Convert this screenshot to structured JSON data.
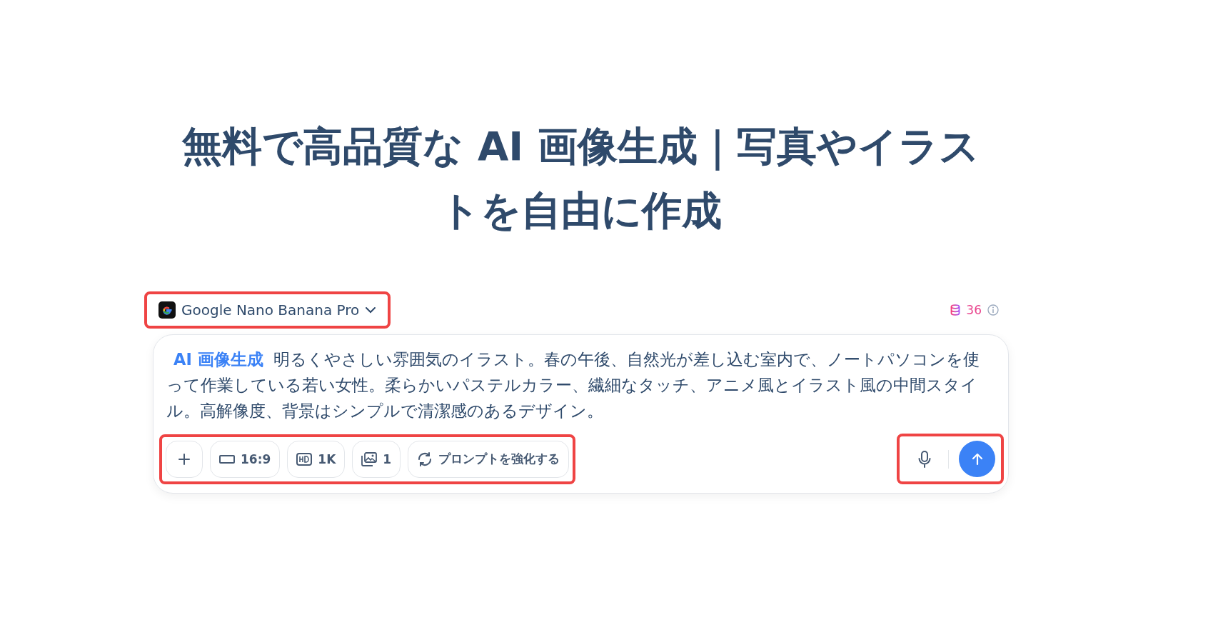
{
  "heading": "無料で高品質な AI 画像生成｜写真やイラストを自由に作成",
  "model_selector": {
    "label": "Google Nano Banana Pro",
    "highlighted": true
  },
  "credits": {
    "count": "36"
  },
  "prompt": {
    "tag": "AI 画像生成",
    "value": "明るくやさしい雰囲気のイラスト。春の午後、自然光が差し込む室内で、ノートパソコンを使って作業している若い女性。柔らかいパステルカラー、繊細なタッチ、アニメ風とイラスト風の中間スタイル。高解像度、背景はシンプルで清潔感のあるデザイン。"
  },
  "toolbar": {
    "highlighted": true,
    "buttons": [
      {
        "kind": "add"
      },
      {
        "kind": "ratio",
        "label": "16:9"
      },
      {
        "kind": "quality",
        "label": "1K"
      },
      {
        "kind": "count",
        "label": "1"
      },
      {
        "kind": "enhance",
        "label": "プロンプトを強化する"
      }
    ]
  },
  "actions": {
    "highlighted": true
  }
}
